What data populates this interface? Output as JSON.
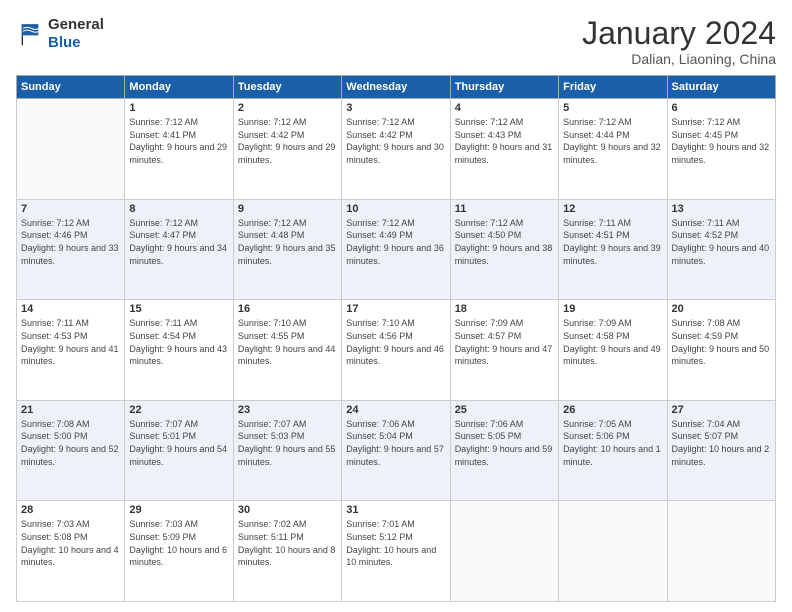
{
  "logo": {
    "general": "General",
    "blue": "Blue"
  },
  "header": {
    "month": "January 2024",
    "location": "Dalian, Liaoning, China"
  },
  "weekdays": [
    "Sunday",
    "Monday",
    "Tuesday",
    "Wednesday",
    "Thursday",
    "Friday",
    "Saturday"
  ],
  "weeks": [
    [
      {
        "day": "",
        "sunrise": "",
        "sunset": "",
        "daylight": "",
        "empty": true
      },
      {
        "day": "1",
        "sunrise": "Sunrise: 7:12 AM",
        "sunset": "Sunset: 4:41 PM",
        "daylight": "Daylight: 9 hours and 29 minutes."
      },
      {
        "day": "2",
        "sunrise": "Sunrise: 7:12 AM",
        "sunset": "Sunset: 4:42 PM",
        "daylight": "Daylight: 9 hours and 29 minutes."
      },
      {
        "day": "3",
        "sunrise": "Sunrise: 7:12 AM",
        "sunset": "Sunset: 4:42 PM",
        "daylight": "Daylight: 9 hours and 30 minutes."
      },
      {
        "day": "4",
        "sunrise": "Sunrise: 7:12 AM",
        "sunset": "Sunset: 4:43 PM",
        "daylight": "Daylight: 9 hours and 31 minutes."
      },
      {
        "day": "5",
        "sunrise": "Sunrise: 7:12 AM",
        "sunset": "Sunset: 4:44 PM",
        "daylight": "Daylight: 9 hours and 32 minutes."
      },
      {
        "day": "6",
        "sunrise": "Sunrise: 7:12 AM",
        "sunset": "Sunset: 4:45 PM",
        "daylight": "Daylight: 9 hours and 32 minutes."
      }
    ],
    [
      {
        "day": "7",
        "sunrise": "Sunrise: 7:12 AM",
        "sunset": "Sunset: 4:46 PM",
        "daylight": "Daylight: 9 hours and 33 minutes."
      },
      {
        "day": "8",
        "sunrise": "Sunrise: 7:12 AM",
        "sunset": "Sunset: 4:47 PM",
        "daylight": "Daylight: 9 hours and 34 minutes."
      },
      {
        "day": "9",
        "sunrise": "Sunrise: 7:12 AM",
        "sunset": "Sunset: 4:48 PM",
        "daylight": "Daylight: 9 hours and 35 minutes."
      },
      {
        "day": "10",
        "sunrise": "Sunrise: 7:12 AM",
        "sunset": "Sunset: 4:49 PM",
        "daylight": "Daylight: 9 hours and 36 minutes."
      },
      {
        "day": "11",
        "sunrise": "Sunrise: 7:12 AM",
        "sunset": "Sunset: 4:50 PM",
        "daylight": "Daylight: 9 hours and 38 minutes."
      },
      {
        "day": "12",
        "sunrise": "Sunrise: 7:11 AM",
        "sunset": "Sunset: 4:51 PM",
        "daylight": "Daylight: 9 hours and 39 minutes."
      },
      {
        "day": "13",
        "sunrise": "Sunrise: 7:11 AM",
        "sunset": "Sunset: 4:52 PM",
        "daylight": "Daylight: 9 hours and 40 minutes."
      }
    ],
    [
      {
        "day": "14",
        "sunrise": "Sunrise: 7:11 AM",
        "sunset": "Sunset: 4:53 PM",
        "daylight": "Daylight: 9 hours and 41 minutes."
      },
      {
        "day": "15",
        "sunrise": "Sunrise: 7:11 AM",
        "sunset": "Sunset: 4:54 PM",
        "daylight": "Daylight: 9 hours and 43 minutes."
      },
      {
        "day": "16",
        "sunrise": "Sunrise: 7:10 AM",
        "sunset": "Sunset: 4:55 PM",
        "daylight": "Daylight: 9 hours and 44 minutes."
      },
      {
        "day": "17",
        "sunrise": "Sunrise: 7:10 AM",
        "sunset": "Sunset: 4:56 PM",
        "daylight": "Daylight: 9 hours and 46 minutes."
      },
      {
        "day": "18",
        "sunrise": "Sunrise: 7:09 AM",
        "sunset": "Sunset: 4:57 PM",
        "daylight": "Daylight: 9 hours and 47 minutes."
      },
      {
        "day": "19",
        "sunrise": "Sunrise: 7:09 AM",
        "sunset": "Sunset: 4:58 PM",
        "daylight": "Daylight: 9 hours and 49 minutes."
      },
      {
        "day": "20",
        "sunrise": "Sunrise: 7:08 AM",
        "sunset": "Sunset: 4:59 PM",
        "daylight": "Daylight: 9 hours and 50 minutes."
      }
    ],
    [
      {
        "day": "21",
        "sunrise": "Sunrise: 7:08 AM",
        "sunset": "Sunset: 5:00 PM",
        "daylight": "Daylight: 9 hours and 52 minutes."
      },
      {
        "day": "22",
        "sunrise": "Sunrise: 7:07 AM",
        "sunset": "Sunset: 5:01 PM",
        "daylight": "Daylight: 9 hours and 54 minutes."
      },
      {
        "day": "23",
        "sunrise": "Sunrise: 7:07 AM",
        "sunset": "Sunset: 5:03 PM",
        "daylight": "Daylight: 9 hours and 55 minutes."
      },
      {
        "day": "24",
        "sunrise": "Sunrise: 7:06 AM",
        "sunset": "Sunset: 5:04 PM",
        "daylight": "Daylight: 9 hours and 57 minutes."
      },
      {
        "day": "25",
        "sunrise": "Sunrise: 7:06 AM",
        "sunset": "Sunset: 5:05 PM",
        "daylight": "Daylight: 9 hours and 59 minutes."
      },
      {
        "day": "26",
        "sunrise": "Sunrise: 7:05 AM",
        "sunset": "Sunset: 5:06 PM",
        "daylight": "Daylight: 10 hours and 1 minute."
      },
      {
        "day": "27",
        "sunrise": "Sunrise: 7:04 AM",
        "sunset": "Sunset: 5:07 PM",
        "daylight": "Daylight: 10 hours and 2 minutes."
      }
    ],
    [
      {
        "day": "28",
        "sunrise": "Sunrise: 7:03 AM",
        "sunset": "Sunset: 5:08 PM",
        "daylight": "Daylight: 10 hours and 4 minutes."
      },
      {
        "day": "29",
        "sunrise": "Sunrise: 7:03 AM",
        "sunset": "Sunset: 5:09 PM",
        "daylight": "Daylight: 10 hours and 6 minutes."
      },
      {
        "day": "30",
        "sunrise": "Sunrise: 7:02 AM",
        "sunset": "Sunset: 5:11 PM",
        "daylight": "Daylight: 10 hours and 8 minutes."
      },
      {
        "day": "31",
        "sunrise": "Sunrise: 7:01 AM",
        "sunset": "Sunset: 5:12 PM",
        "daylight": "Daylight: 10 hours and 10 minutes."
      },
      {
        "day": "",
        "sunrise": "",
        "sunset": "",
        "daylight": "",
        "empty": true
      },
      {
        "day": "",
        "sunrise": "",
        "sunset": "",
        "daylight": "",
        "empty": true
      },
      {
        "day": "",
        "sunrise": "",
        "sunset": "",
        "daylight": "",
        "empty": true
      }
    ]
  ]
}
